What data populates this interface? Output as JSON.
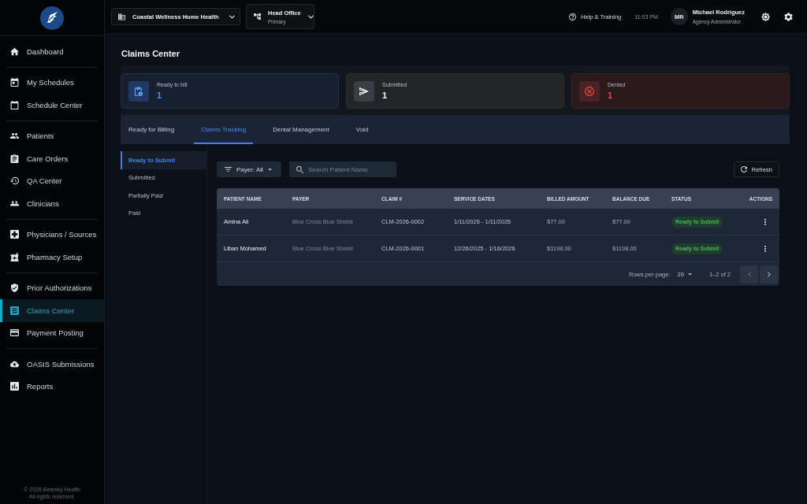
{
  "sidebar": {
    "groups": [
      {
        "items": [
          {
            "label": "Dashboard",
            "selected": false
          }
        ]
      },
      {
        "items": [
          {
            "label": "My Schedules",
            "selected": false
          },
          {
            "label": "Schedule Center",
            "selected": false
          }
        ]
      },
      {
        "items": [
          {
            "label": "Patients",
            "selected": false
          },
          {
            "label": "Care Orders",
            "selected": false
          },
          {
            "label": "QA Center",
            "selected": false
          },
          {
            "label": "Clinicians",
            "selected": false
          }
        ]
      },
      {
        "items": [
          {
            "label": "Physicians / Sources",
            "selected": false
          },
          {
            "label": "Pharmacy Setup",
            "selected": false
          }
        ]
      },
      {
        "items": [
          {
            "label": "Prior Authorizations",
            "selected": false
          },
          {
            "label": "Claims Center",
            "selected": true
          },
          {
            "label": "Payment Posting",
            "selected": false
          }
        ]
      },
      {
        "items": [
          {
            "label": "OASIS Submissions",
            "selected": false
          },
          {
            "label": "Reports",
            "selected": false
          }
        ]
      }
    ],
    "footer": [
      "© 2026 Betesky Health",
      "All rights reserved."
    ]
  },
  "top_bar": {
    "organization": "Coastal Wellness Home Health",
    "location": {
      "name": "Head Office",
      "subtitle": "Primary"
    },
    "help": "Help & Training",
    "time": "11:03 PM",
    "user": {
      "initials": "MR",
      "name": "Michael Rodriguez",
      "role": "Agency Administrator"
    }
  },
  "page_title": "Claims Center",
  "summary": [
    {
      "kind": "ready",
      "label": "Ready to bill",
      "value": "1"
    },
    {
      "kind": "submitted",
      "label": "Submitted",
      "value": "1"
    },
    {
      "kind": "denied",
      "label": "Denied",
      "value": "1"
    }
  ],
  "tabs": [
    {
      "label": "Ready for Billing",
      "selected": false
    },
    {
      "label": "Claims Tracking",
      "selected": true
    },
    {
      "label": "Denial Management",
      "selected": false
    },
    {
      "label": "Void",
      "selected": false
    }
  ],
  "status_filters": [
    {
      "label": "Ready to Submit",
      "selected": true
    },
    {
      "label": "Submitted",
      "selected": false
    },
    {
      "label": "Partially Paid",
      "selected": false
    },
    {
      "label": "Paid",
      "selected": false
    }
  ],
  "toolbar": {
    "payer_filter": "Payer: All",
    "search": {
      "placeholder": "Search Patient Name"
    },
    "refresh": "Refresh"
  },
  "table": {
    "columns": [
      "PATIENT NAME",
      "PAYER",
      "CLAIM #",
      "SERVICE DATES",
      "BILLED AMOUNT",
      "BALANCE DUE",
      "STATUS",
      "ACTIONS"
    ],
    "rows": [
      {
        "cells": [
          "Amina Ali",
          "Blue Cross Blue Shield",
          "CLM-2026-0002",
          "1/11/2026 - 1/11/2026",
          "$77.00",
          "$77.00"
        ],
        "status": "Ready to Submit"
      },
      {
        "cells": [
          "Liban Mohamed",
          "Blue Cross Blue Shield",
          "CLM-2026-0001",
          "12/26/2025 - 1/16/2026",
          "$1198.00",
          "$1198.00"
        ],
        "status": "Ready to Submit"
      }
    ]
  },
  "pagination": {
    "rows_per_page_label": "Rows per page:",
    "rows_per_page": "20",
    "range": "1–2 of 2",
    "previous_page": {
      "disabled": true
    },
    "next_page": {
      "disabled": false
    }
  }
}
